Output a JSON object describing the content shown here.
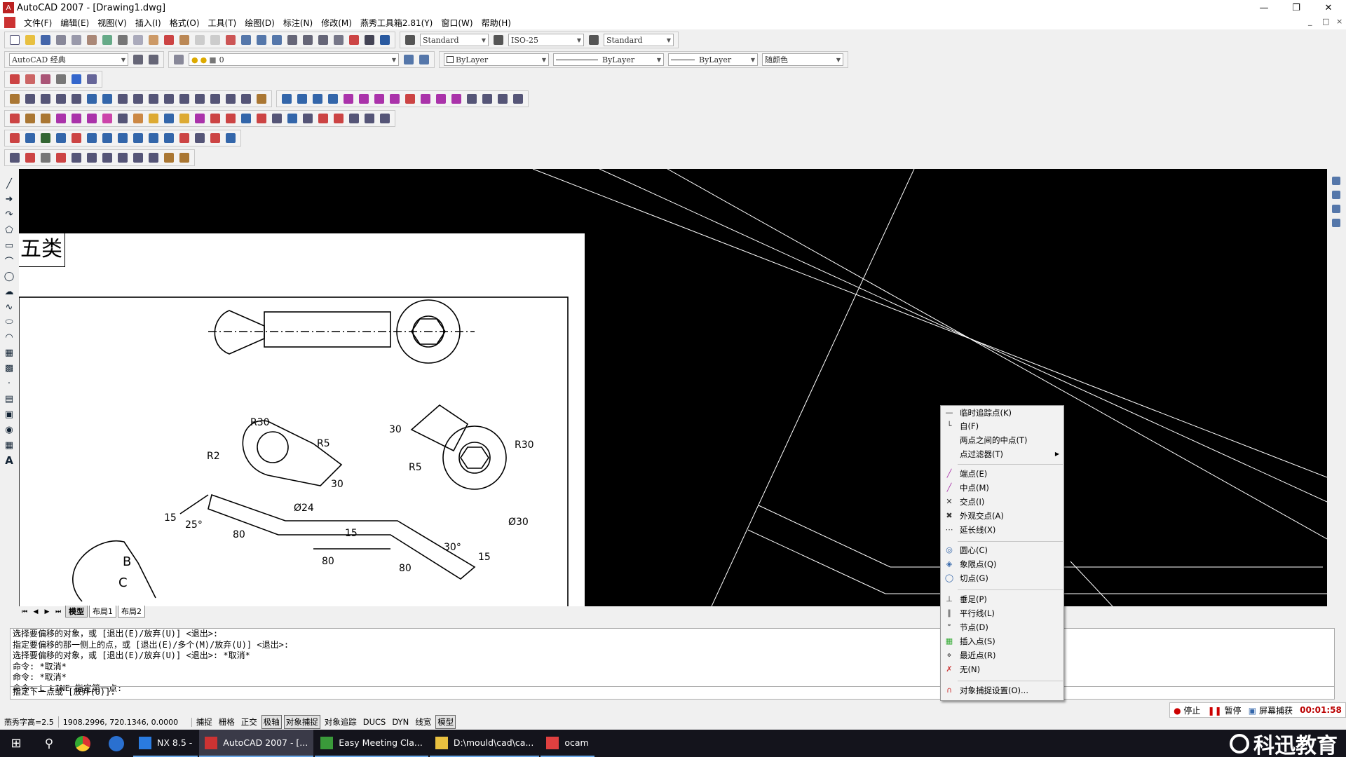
{
  "window": {
    "title": "AutoCAD 2007 - [Drawing1.dwg]"
  },
  "menu": [
    "文件(F)",
    "编辑(E)",
    "视图(V)",
    "插入(I)",
    "格式(O)",
    "工具(T)",
    "绘图(D)",
    "标注(N)",
    "修改(M)",
    "燕秀工具箱2.81(Y)",
    "窗口(W)",
    "帮助(H)"
  ],
  "toolbar": {
    "text_style": "Standard",
    "dim_style": "ISO-25",
    "table_style": "Standard",
    "workspace": "AutoCAD 经典",
    "layer": "0",
    "color": "ByLayer",
    "linetype": "ByLayer",
    "lineweight": "ByLayer",
    "plotstyle": "随颜色"
  },
  "drawing": {
    "paper_label": "五类",
    "dimensions": [
      "R30",
      "R2",
      "R5",
      "30",
      "Ø24",
      "30",
      "R30",
      "R5",
      "Ø30",
      "15",
      "25°",
      "80",
      "15",
      "80",
      "30°",
      "80",
      "15",
      "B",
      "C"
    ]
  },
  "layout_tabs": [
    "模型",
    "布局1",
    "布局2"
  ],
  "command_history": [
    "选择要偏移的对象，或 [退出(E)/放弃(U)] <退出>:",
    "指定要偏移的那一侧上的点，或 [退出(E)/多个(M)/放弃(U)] <退出>:",
    "选择要偏移的对象，或 [退出(E)/放弃(U)] <退出>: *取消*",
    "命令: *取消*",
    "命令: *取消*",
    "命令: L LINE 指定第一点:"
  ],
  "command_prompt": "指定下一点或 [放弃(U)]:",
  "context_menu": {
    "items": [
      {
        "label": "临时追踪点(K)",
        "icon": "track-icon"
      },
      {
        "label": "自(F)",
        "icon": "from-icon"
      },
      {
        "label": "两点之间的中点(T)",
        "icon": ""
      },
      {
        "label": "点过滤器(T)",
        "icon": "",
        "submenu": true
      },
      {
        "label": "端点(E)",
        "icon": "endpoint-icon"
      },
      {
        "label": "中点(M)",
        "icon": "midpoint-icon"
      },
      {
        "label": "交点(I)",
        "icon": "intersection-icon"
      },
      {
        "label": "外观交点(A)",
        "icon": "apparent-intersection-icon"
      },
      {
        "label": "延长线(X)",
        "icon": "extension-icon"
      },
      {
        "label": "圆心(C)",
        "icon": "center-icon"
      },
      {
        "label": "象限点(Q)",
        "icon": "quadrant-icon"
      },
      {
        "label": "切点(G)",
        "icon": "tangent-icon"
      },
      {
        "label": "垂足(P)",
        "icon": "perpendicular-icon"
      },
      {
        "label": "平行线(L)",
        "icon": "parallel-icon"
      },
      {
        "label": "节点(D)",
        "icon": "node-icon"
      },
      {
        "label": "插入点(S)",
        "icon": "insert-icon"
      },
      {
        "label": "最近点(R)",
        "icon": "nearest-icon"
      },
      {
        "label": "无(N)",
        "icon": "none-icon"
      },
      {
        "label": "对象捕捉设置(O)...",
        "icon": "osnap-settings-icon"
      }
    ]
  },
  "status": {
    "text_height": "燕秀字高=2.5",
    "coords": "1908.2996,  720.1346,  0.0000",
    "toggles": [
      {
        "label": "捕捉",
        "on": false
      },
      {
        "label": "栅格",
        "on": false
      },
      {
        "label": "正交",
        "on": false
      },
      {
        "label": "极轴",
        "on": true
      },
      {
        "label": "对象捕捉",
        "on": true
      },
      {
        "label": "对象追踪",
        "on": false
      },
      {
        "label": "DUCS",
        "on": false
      },
      {
        "label": "DYN",
        "on": false
      },
      {
        "label": "线宽",
        "on": false
      },
      {
        "label": "模型",
        "on": true
      }
    ]
  },
  "recorder": {
    "stop": "停止",
    "pause": "暂停",
    "capture": "屏幕捕获",
    "time": "00:01:58"
  },
  "taskbar": {
    "tasks": [
      {
        "label": "NX 8.5 -",
        "color": "#2a7be0"
      },
      {
        "label": "AutoCAD 2007 - [...",
        "color": "#c33",
        "active": true
      },
      {
        "label": "Easy Meeting Cla...",
        "color": "#3a9a3a"
      },
      {
        "label": "D:\\mould\\cad\\ca...",
        "color": "#e8c040"
      },
      {
        "label": "ocam",
        "color": "#e04040"
      }
    ],
    "watermark": "科迅教育"
  }
}
